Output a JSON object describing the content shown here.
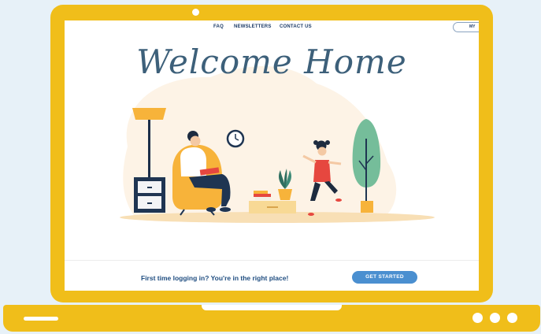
{
  "nav": {
    "links": [
      "FAQ",
      "NEWSLETTERS",
      "CONTACT US"
    ],
    "account_label": "MY"
  },
  "hero": {
    "title": "Welcome Home"
  },
  "cta": {
    "text": "First time logging in? You're in the right place!",
    "button_label": "GET STARTED"
  },
  "colors": {
    "frame": "#f0be1a",
    "background": "#e7f1f8",
    "button": "#4a8fd0",
    "cta_text": "#1f4d80"
  }
}
